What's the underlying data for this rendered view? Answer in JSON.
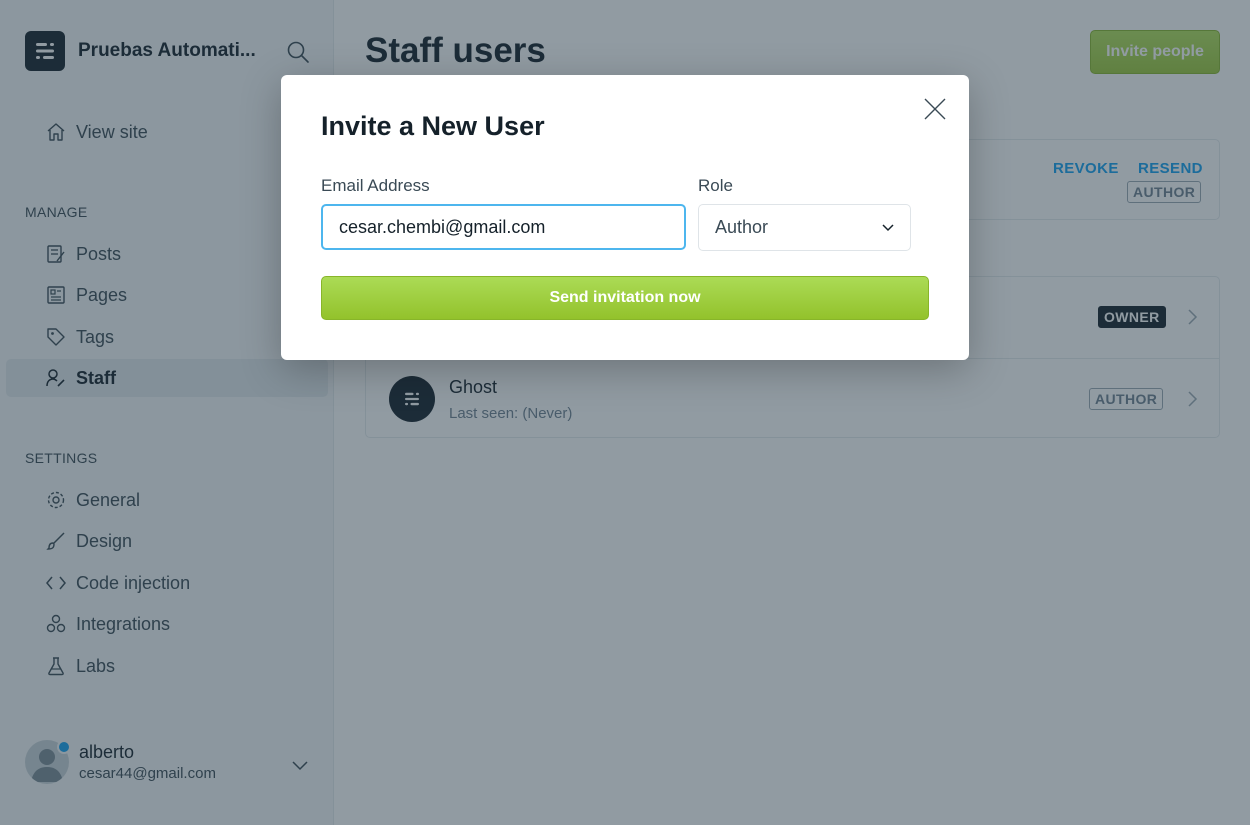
{
  "sidebar": {
    "site_name": "Pruebas Automati...",
    "view_site": "View site",
    "manage_label": "MANAGE",
    "manage_items": [
      "Posts",
      "Pages",
      "Tags",
      "Staff"
    ],
    "settings_label": "SETTINGS",
    "settings_items": [
      "General",
      "Design",
      "Code injection",
      "Integrations",
      "Labs"
    ],
    "user": {
      "name": "alberto",
      "email": "cesar44@gmail.com"
    }
  },
  "main": {
    "title": "Staff users",
    "invite_button": "Invite people",
    "invites": {
      "revoke": "REVOKE",
      "resend": "RESEND",
      "role": "AUTHOR"
    },
    "users": [
      {
        "role": "OWNER"
      },
      {
        "name": "Ghost",
        "last_seen": "Last seen: (Never)",
        "role": "AUTHOR"
      }
    ]
  },
  "modal": {
    "title": "Invite a New User",
    "email_label": "Email Address",
    "email_value": "cesar.chembi@gmail.com",
    "role_label": "Role",
    "role_value": "Author",
    "submit": "Send invitation now"
  },
  "colors": {
    "accent_green": "#9dc93d",
    "link_blue": "#14a0f0",
    "dark": "#15212a"
  }
}
